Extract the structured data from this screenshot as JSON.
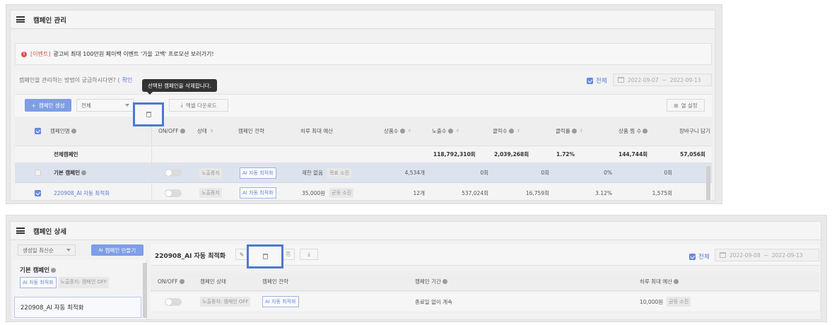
{
  "panel1": {
    "title": "캠페인 관리",
    "notice": {
      "tag": "[이벤트]",
      "message": "광고비 최대 100만원 페이백 이벤트 '가을 고백' 프로모션 보러가기!"
    },
    "help": {
      "text": "캠페인을 관리하는 방법이 궁금하시다면? (",
      "link": "확인"
    },
    "filter": {
      "all_label": "전체",
      "date_start": "2022-09-07",
      "date_end": "2022-09-13"
    },
    "toolbar": {
      "create_button": "캠페인 생성",
      "select_value": "전체",
      "excel_button": "엑셀 다운로드",
      "column_settings_button": "열 설정",
      "tooltip": "선택된 캠페인을 삭제합니다."
    },
    "table": {
      "headers": [
        "캠페인명",
        "ON/OFF",
        "상태",
        "캠페인 전략",
        "하루 최대 예산",
        "상품수",
        "노출수",
        "클릭수",
        "클릭률",
        "상품 찜 수",
        "장바구니 담기"
      ],
      "summary": {
        "label": "전체캠페인",
        "impressions": "118,792,310회",
        "clicks": "2,039,268회",
        "ctr": "1.72%",
        "wishes": "144,744회",
        "cart": "57,056회"
      },
      "rows": [
        {
          "name": "기본 캠페인",
          "status": "노출중지",
          "strategy": "AI 자동 최적화",
          "budget": "제한 없음",
          "budget_tag": "목표 소진",
          "products": "4,534개",
          "impressions": "0회",
          "clicks": "0회",
          "ctr": "0%",
          "wishes": "0회"
        },
        {
          "name": "220908_AI 자동 최적화",
          "status": "노출중지",
          "strategy": "AI 자동 최적화",
          "budget": "35,000원",
          "budget_tag": "균등 소진",
          "products": "12개",
          "impressions": "537,024회",
          "clicks": "16,759회",
          "ctr": "3.12%",
          "wishes": "1,575회"
        }
      ]
    }
  },
  "panel2": {
    "title": "캠페인 상세",
    "sidebar": {
      "sort_select": "생성일 최신순",
      "create_button": "캠페인 만들기",
      "items": [
        {
          "name": "기본 캠페인",
          "tags": [
            "AI 자동 최적화",
            "노출중지: 캠페인 OFF"
          ]
        },
        {
          "name": "220908_AI 자동 최적화"
        }
      ]
    },
    "detail": {
      "campaign_name": "220908_AI 자동 최적화",
      "all_label": "전체",
      "date_start": "2022-09-08",
      "date_end": "2022-09-13",
      "headers": [
        "ON/OFF",
        "캠페인 상태",
        "캠페인 전략",
        "캠페인 기간",
        "하루 최대 예산"
      ],
      "row": {
        "status": "노출중지: 캠페인 OFF",
        "strategy": "AI 자동 최적화",
        "period": "종료일 없이 계속",
        "budget": "10,000원",
        "budget_tag": "균등 소진"
      }
    }
  },
  "colors": {
    "accent": "#7e9ee6",
    "highlight": "#4e79d1",
    "warning": "#d9534f"
  }
}
